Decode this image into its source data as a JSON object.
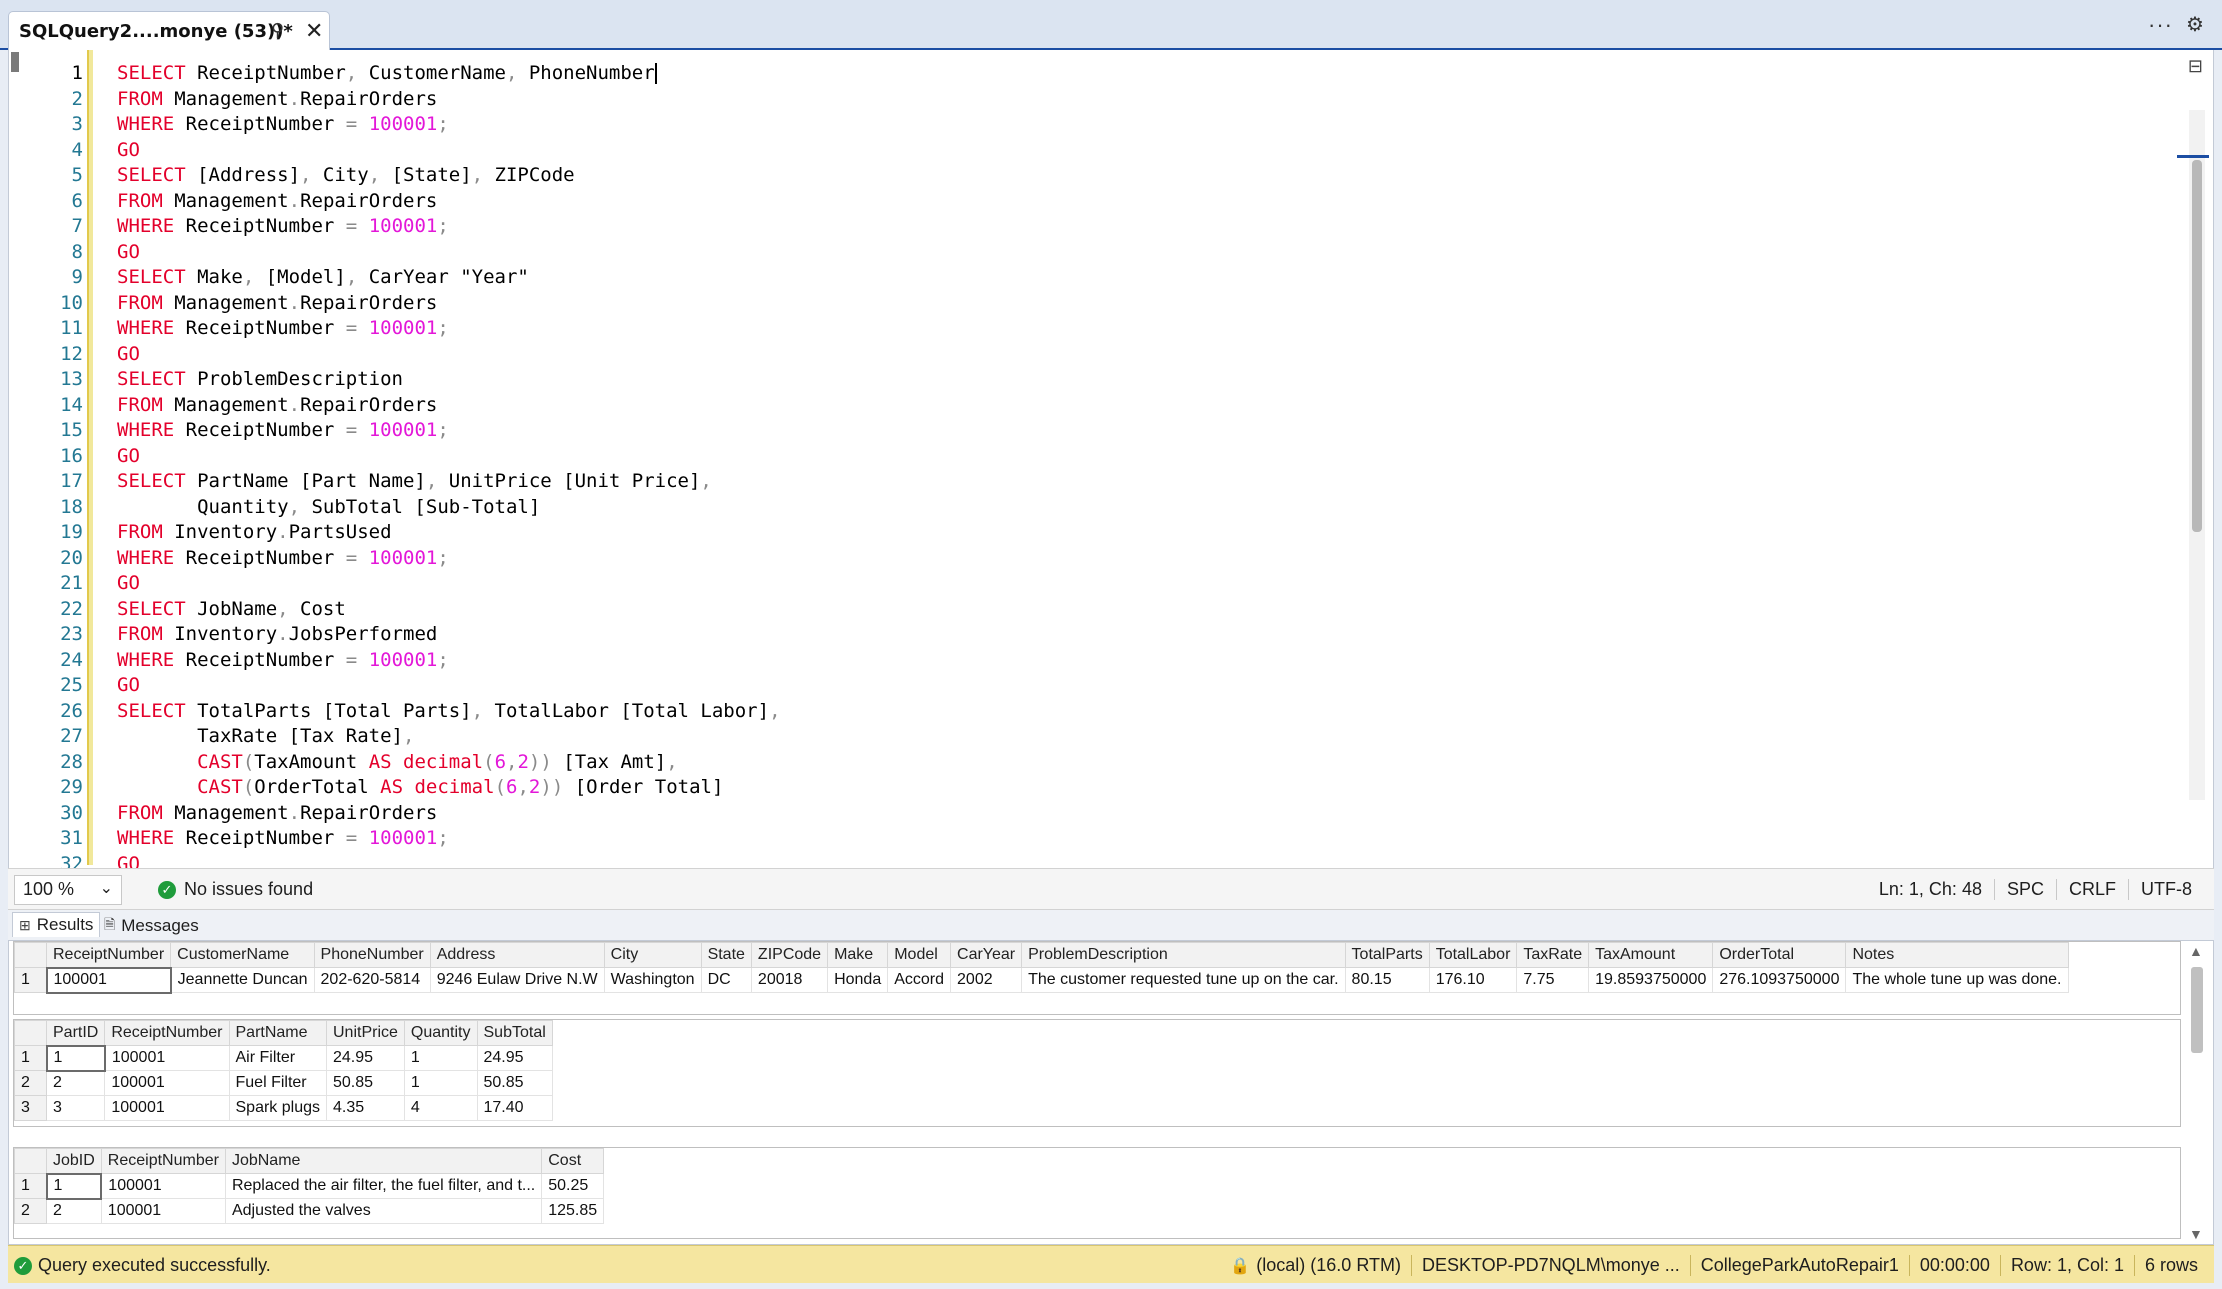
{
  "tab": {
    "title": "SQLQuery2....monye (53))*",
    "pin_icon": "pin-icon",
    "close_icon": "close-icon"
  },
  "strip": {
    "more": "···",
    "gear": "⚙"
  },
  "editor": {
    "current_line": 1,
    "lines": [
      [
        [
          "kw",
          "SELECT"
        ],
        [
          "t",
          " ReceiptNumber"
        ],
        [
          "pn",
          ","
        ],
        [
          "t",
          " CustomerName"
        ],
        [
          "pn",
          ","
        ],
        [
          "t",
          " PhoneNumber"
        ],
        [
          "caret",
          ""
        ]
      ],
      [
        [
          "kw",
          "FROM"
        ],
        [
          "t",
          " Management"
        ],
        [
          "pn",
          "."
        ],
        [
          "t",
          "RepairOrders"
        ]
      ],
      [
        [
          "kw",
          "WHERE"
        ],
        [
          "t",
          " ReceiptNumber "
        ],
        [
          "pn",
          "="
        ],
        [
          "t",
          " "
        ],
        [
          "num",
          "100001"
        ],
        [
          "pn",
          ";"
        ]
      ],
      [
        [
          "kw",
          "GO"
        ]
      ],
      [
        [
          "kw",
          "SELECT"
        ],
        [
          "t",
          " [Address]"
        ],
        [
          "pn",
          ","
        ],
        [
          "t",
          " City"
        ],
        [
          "pn",
          ","
        ],
        [
          "t",
          " [State]"
        ],
        [
          "pn",
          ","
        ],
        [
          "t",
          " ZIPCode"
        ]
      ],
      [
        [
          "kw",
          "FROM"
        ],
        [
          "t",
          " Management"
        ],
        [
          "pn",
          "."
        ],
        [
          "t",
          "RepairOrders"
        ]
      ],
      [
        [
          "kw",
          "WHERE"
        ],
        [
          "t",
          " ReceiptNumber "
        ],
        [
          "pn",
          "="
        ],
        [
          "t",
          " "
        ],
        [
          "num",
          "100001"
        ],
        [
          "pn",
          ";"
        ]
      ],
      [
        [
          "kw",
          "GO"
        ]
      ],
      [
        [
          "kw",
          "SELECT"
        ],
        [
          "t",
          " Make"
        ],
        [
          "pn",
          ","
        ],
        [
          "t",
          " [Model]"
        ],
        [
          "pn",
          ","
        ],
        [
          "t",
          " CarYear \"Year\""
        ]
      ],
      [
        [
          "kw",
          "FROM"
        ],
        [
          "t",
          " Management"
        ],
        [
          "pn",
          "."
        ],
        [
          "t",
          "RepairOrders"
        ]
      ],
      [
        [
          "kw",
          "WHERE"
        ],
        [
          "t",
          " ReceiptNumber "
        ],
        [
          "pn",
          "="
        ],
        [
          "t",
          " "
        ],
        [
          "num",
          "100001"
        ],
        [
          "pn",
          ";"
        ]
      ],
      [
        [
          "kw",
          "GO"
        ]
      ],
      [
        [
          "kw",
          "SELECT"
        ],
        [
          "t",
          " ProblemDescription"
        ]
      ],
      [
        [
          "kw",
          "FROM"
        ],
        [
          "t",
          " Management"
        ],
        [
          "pn",
          "."
        ],
        [
          "t",
          "RepairOrders"
        ]
      ],
      [
        [
          "kw",
          "WHERE"
        ],
        [
          "t",
          " ReceiptNumber "
        ],
        [
          "pn",
          "="
        ],
        [
          "t",
          " "
        ],
        [
          "num",
          "100001"
        ],
        [
          "pn",
          ";"
        ]
      ],
      [
        [
          "kw",
          "GO"
        ]
      ],
      [
        [
          "kw",
          "SELECT"
        ],
        [
          "t",
          " PartName [Part Name]"
        ],
        [
          "pn",
          ","
        ],
        [
          "t",
          " UnitPrice [Unit Price]"
        ],
        [
          "pn",
          ","
        ]
      ],
      [
        [
          "t",
          "       Quantity"
        ],
        [
          "pn",
          ","
        ],
        [
          "t",
          " SubTotal [Sub-Total]"
        ]
      ],
      [
        [
          "kw",
          "FROM"
        ],
        [
          "t",
          " Inventory"
        ],
        [
          "pn",
          "."
        ],
        [
          "t",
          "PartsUsed"
        ]
      ],
      [
        [
          "kw",
          "WHERE"
        ],
        [
          "t",
          " ReceiptNumber "
        ],
        [
          "pn",
          "="
        ],
        [
          "t",
          " "
        ],
        [
          "num",
          "100001"
        ],
        [
          "pn",
          ";"
        ]
      ],
      [
        [
          "kw",
          "GO"
        ]
      ],
      [
        [
          "kw",
          "SELECT"
        ],
        [
          "t",
          " JobName"
        ],
        [
          "pn",
          ","
        ],
        [
          "t",
          " Cost"
        ]
      ],
      [
        [
          "kw",
          "FROM"
        ],
        [
          "t",
          " Inventory"
        ],
        [
          "pn",
          "."
        ],
        [
          "t",
          "JobsPerformed"
        ]
      ],
      [
        [
          "kw",
          "WHERE"
        ],
        [
          "t",
          " ReceiptNumber "
        ],
        [
          "pn",
          "="
        ],
        [
          "t",
          " "
        ],
        [
          "num",
          "100001"
        ],
        [
          "pn",
          ";"
        ]
      ],
      [
        [
          "kw",
          "GO"
        ]
      ],
      [
        [
          "kw",
          "SELECT"
        ],
        [
          "t",
          " TotalParts [Total Parts]"
        ],
        [
          "pn",
          ","
        ],
        [
          "t",
          " TotalLabor [Total Labor]"
        ],
        [
          "pn",
          ","
        ]
      ],
      [
        [
          "t",
          "       TaxRate [Tax Rate]"
        ],
        [
          "pn",
          ","
        ]
      ],
      [
        [
          "t",
          "       "
        ],
        [
          "kw",
          "CAST"
        ],
        [
          "pn",
          "("
        ],
        [
          "t",
          "TaxAmount "
        ],
        [
          "kw",
          "AS"
        ],
        [
          "t",
          " "
        ],
        [
          "kw",
          "decimal"
        ],
        [
          "pn",
          "("
        ],
        [
          "num",
          "6"
        ],
        [
          "pn",
          ","
        ],
        [
          "num",
          "2"
        ],
        [
          "pn",
          "))"
        ],
        [
          "t",
          " [Tax Amt]"
        ],
        [
          "pn",
          ","
        ]
      ],
      [
        [
          "t",
          "       "
        ],
        [
          "kw",
          "CAST"
        ],
        [
          "pn",
          "("
        ],
        [
          "t",
          "OrderTotal "
        ],
        [
          "kw",
          "AS"
        ],
        [
          "t",
          " "
        ],
        [
          "kw",
          "decimal"
        ],
        [
          "pn",
          "("
        ],
        [
          "num",
          "6"
        ],
        [
          "pn",
          ","
        ],
        [
          "num",
          "2"
        ],
        [
          "pn",
          "))"
        ],
        [
          "t",
          " [Order Total]"
        ]
      ],
      [
        [
          "kw",
          "FROM"
        ],
        [
          "t",
          " Management"
        ],
        [
          "pn",
          "."
        ],
        [
          "t",
          "RepairOrders"
        ]
      ],
      [
        [
          "kw",
          "WHERE"
        ],
        [
          "t",
          " ReceiptNumber "
        ],
        [
          "pn",
          "="
        ],
        [
          "t",
          " "
        ],
        [
          "num",
          "100001"
        ],
        [
          "pn",
          ";"
        ]
      ],
      [
        [
          "kw",
          "GO"
        ]
      ]
    ]
  },
  "editor_status": {
    "zoom": "100 %",
    "issues": "No issues found",
    "position": "Ln: 1, Ch: 48",
    "whitespace": "SPC",
    "line_ending": "CRLF",
    "encoding": "UTF-8"
  },
  "result_tabs": {
    "results": "Results",
    "messages": "Messages"
  },
  "grids": [
    {
      "columns": [
        "ReceiptNumber",
        "CustomerName",
        "PhoneNumber",
        "Address",
        "City",
        "State",
        "ZIPCode",
        "Make",
        "Model",
        "CarYear",
        "ProblemDescription",
        "TotalParts",
        "TotalLabor",
        "TaxRate",
        "TaxAmount",
        "OrderTotal",
        "Notes"
      ],
      "rows": [
        [
          "1",
          "100001",
          "Jeannette Duncan",
          "202-620-5814",
          "9246 Eulaw Drive N.W",
          "Washington",
          "DC",
          "20018",
          "Honda",
          "Accord",
          "2002",
          "The customer requested tune up on the car.",
          "80.15",
          "176.10",
          "7.75",
          "19.8593750000",
          "276.1093750000",
          "The whole tune up was done."
        ]
      ]
    },
    {
      "columns": [
        "PartID",
        "ReceiptNumber",
        "PartName",
        "UnitPrice",
        "Quantity",
        "SubTotal"
      ],
      "rows": [
        [
          "1",
          "1",
          "100001",
          "Air Filter",
          "24.95",
          "1",
          "24.95"
        ],
        [
          "2",
          "2",
          "100001",
          "Fuel Filter",
          "50.85",
          "1",
          "50.85"
        ],
        [
          "3",
          "3",
          "100001",
          "Spark plugs",
          "4.35",
          "4",
          "17.40"
        ]
      ]
    },
    {
      "columns": [
        "JobID",
        "ReceiptNumber",
        "JobName",
        "Cost"
      ],
      "rows": [
        [
          "1",
          "1",
          "100001",
          "Replaced the air filter, the fuel filter, and t...",
          "50.25"
        ],
        [
          "2",
          "2",
          "100001",
          "Adjusted the valves",
          "125.85"
        ]
      ]
    }
  ],
  "query_status": {
    "message": "Query executed successfully.",
    "server": "(local) (16.0 RTM)",
    "user": "DESKTOP-PD7NQLM\\monye ...",
    "database": "CollegeParkAutoRepair1",
    "elapsed": "00:00:00",
    "position": "Row: 1, Col: 1",
    "rows": "6 rows"
  }
}
